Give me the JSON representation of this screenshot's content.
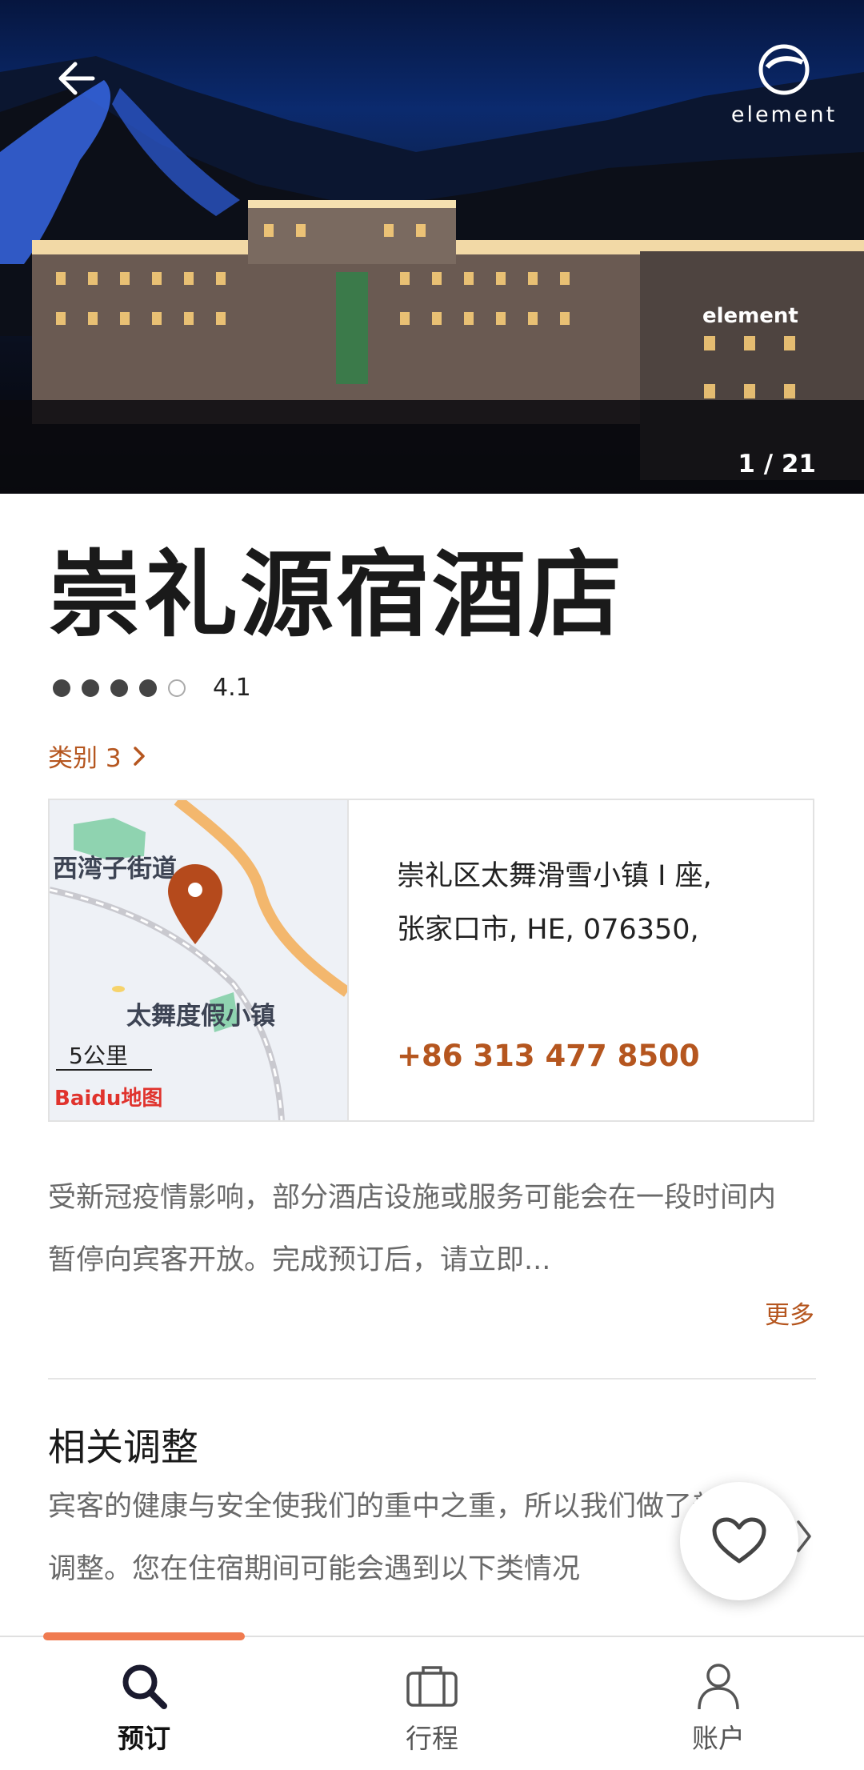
{
  "hero": {
    "brand": "element",
    "sign_text": "element",
    "photo_counter": "1 / 21"
  },
  "hotel": {
    "name": "崇礼源宿酒店",
    "rating_dots": 4,
    "rating_max": 5,
    "rating_value": "4.1",
    "category_label": "类别 3"
  },
  "location": {
    "map_labels": {
      "district": "西湾子街道",
      "resort": "太舞度假小镇",
      "scale": "5公里",
      "provider": "Baidu地图"
    },
    "address_line1": "崇礼区太舞滑雪小镇 I 座,",
    "address_line2": "张家口市, HE, 076350,",
    "phone": "+86 313 477 8500"
  },
  "notice": {
    "text": "受新冠疫情影响，部分酒店设施或服务可能会在一段时间内暂停向宾客开放。完成预订后，请立即...",
    "more_label": "更多"
  },
  "adjustments": {
    "title": "相关调整",
    "body": "宾客的健康与安全使我们的重中之重，所以我们做了部分调整。您在住宿期间可能会遇到以下类情况"
  },
  "nav": {
    "items": [
      {
        "label": "预订",
        "icon": "search-icon",
        "active": true
      },
      {
        "label": "行程",
        "icon": "briefcase-icon",
        "active": false
      },
      {
        "label": "账户",
        "icon": "person-icon",
        "active": false
      }
    ]
  },
  "colors": {
    "accent": "#b5561f",
    "progress": "#f07b50",
    "map_pin": "#b54a1c"
  }
}
